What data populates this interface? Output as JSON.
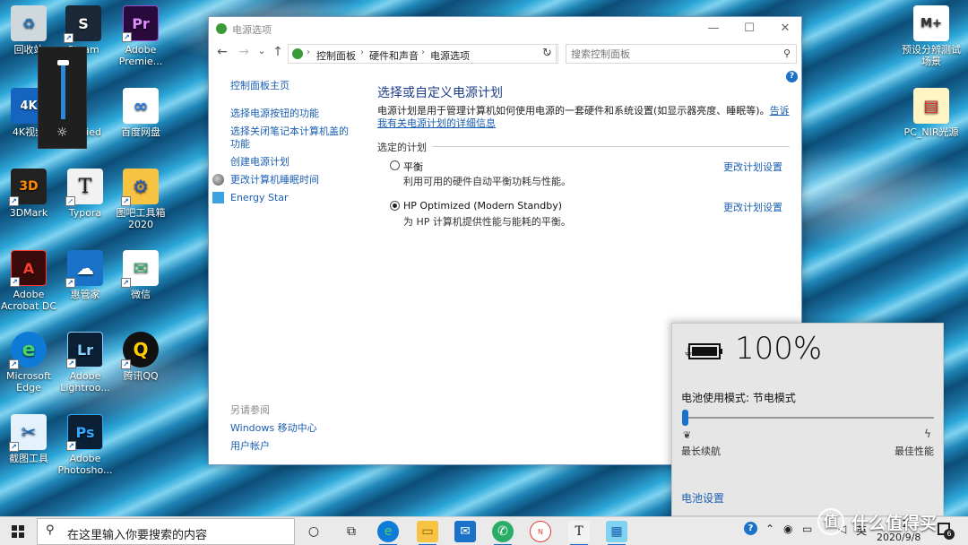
{
  "desktop": {
    "icons": [
      {
        "label": "回收站",
        "glyph": "♻",
        "bg": "#cfd8dc",
        "fg": "#1e73be"
      },
      {
        "label": "Steam",
        "glyph": "S",
        "bg": "#1b2838",
        "fg": "#ffffff"
      },
      {
        "label": "Adobe Premie...",
        "glyph": "Pr",
        "bg": "#2a0a3c",
        "fg": "#e08bff"
      },
      {
        "label": "4K视频",
        "glyph": "4K",
        "bg": "#1565c0",
        "fg": "#ffffff"
      },
      {
        "label": "O ified",
        "glyph": "",
        "bg": "#1a2b2a",
        "fg": "#6fd0a0"
      },
      {
        "label": "百度网盘",
        "glyph": "∞",
        "bg": "#ffffff",
        "fg": "#2b7de9"
      },
      {
        "label": "3DMark",
        "glyph": "3D",
        "bg": "#222222",
        "fg": "#ff8a00"
      },
      {
        "label": "Typora",
        "glyph": "T",
        "bg": "#f2f2f2",
        "fg": "#222222"
      },
      {
        "label": "图吧工具箱 2020",
        "glyph": "⚙",
        "bg": "#f6c343",
        "fg": "#2a5bb8"
      },
      {
        "label": "Adobe Acrobat DC",
        "glyph": "A",
        "bg": "#3a0b0b",
        "fg": "#ff3b30"
      },
      {
        "label": "惠管家",
        "glyph": "☁",
        "bg": "#1a73c8",
        "fg": "#ffffff"
      },
      {
        "label": "微信",
        "glyph": "✉",
        "bg": "#ffffff",
        "fg": "#2aae67"
      },
      {
        "label": "Microsoft Edge",
        "glyph": "e",
        "bg": "#0f7bd8",
        "fg": "#49d36b"
      },
      {
        "label": "Adobe Lightroo...",
        "glyph": "Lr",
        "bg": "#0b2034",
        "fg": "#8ad0ff"
      },
      {
        "label": "腾讯QQ",
        "glyph": "Q",
        "bg": "#111111",
        "fg": "#ffcc00"
      },
      {
        "label": "截图工具",
        "glyph": "✂",
        "bg": "#e3f2fd",
        "fg": "#1565c0"
      },
      {
        "label": "Adobe Photosho...",
        "glyph": "Ps",
        "bg": "#0b2034",
        "fg": "#31a8ff"
      },
      {
        "label": "预设分辨测试场景",
        "glyph": "M+",
        "bg": "#ffffff",
        "fg": "#333333"
      },
      {
        "label": "PC_NIR光源",
        "glyph": "▤",
        "bg": "#fff4c2",
        "fg": "#d32f2f"
      }
    ]
  },
  "brightness": {
    "level_percent": 95
  },
  "window": {
    "title": "电源选项",
    "nav": {
      "back": "←",
      "forward": "→",
      "recent": "⌄",
      "up": "↑"
    },
    "breadcrumb": [
      "控制面板",
      "硬件和声音",
      "电源选项"
    ],
    "search_placeholder": "搜索控制面板",
    "left_links": [
      "控制面板主页",
      "选择电源按钮的功能",
      "选择关闭笔记本计算机盖的功能",
      "创建电源计划",
      "更改计算机睡眠时间",
      "Energy Star"
    ],
    "heading": "选择或自定义电源计划",
    "description": "电源计划是用于管理计算机如何使用电源的一套硬件和系统设置(如显示器亮度、睡眠等)。",
    "description_link": "告诉我有关电源计划的详细信息",
    "section": "选定的计划",
    "plans": [
      {
        "name": "平衡",
        "sub": "利用可用的硬件自动平衡功耗与性能。",
        "change": "更改计划设置",
        "selected": false
      },
      {
        "name": "HP Optimized (Modern Standby)",
        "sub": "为 HP 计算机提供性能与能耗的平衡。",
        "change": "更改计划设置",
        "selected": true
      }
    ],
    "see_also": "另请参阅",
    "see_also_links": [
      "Windows 移动中心",
      "用户帐户"
    ]
  },
  "battery": {
    "percent": "100%",
    "mode_label": "电池使用模式: 节电模式",
    "slider_value": 0,
    "left_label": "最长续航",
    "right_label": "最佳性能",
    "settings_link": "电池设置"
  },
  "taskbar": {
    "search_placeholder": "在这里输入你要搜索的内容",
    "apps": [
      "task-view",
      "cortana",
      "edge",
      "file-explorer",
      "mail",
      "wechat",
      "nuro",
      "typora",
      "control-panel"
    ],
    "tray_lang": "英",
    "time": "9:1",
    "date": "2020/9/8",
    "notification_count": "6"
  },
  "watermark": "什么值得买"
}
